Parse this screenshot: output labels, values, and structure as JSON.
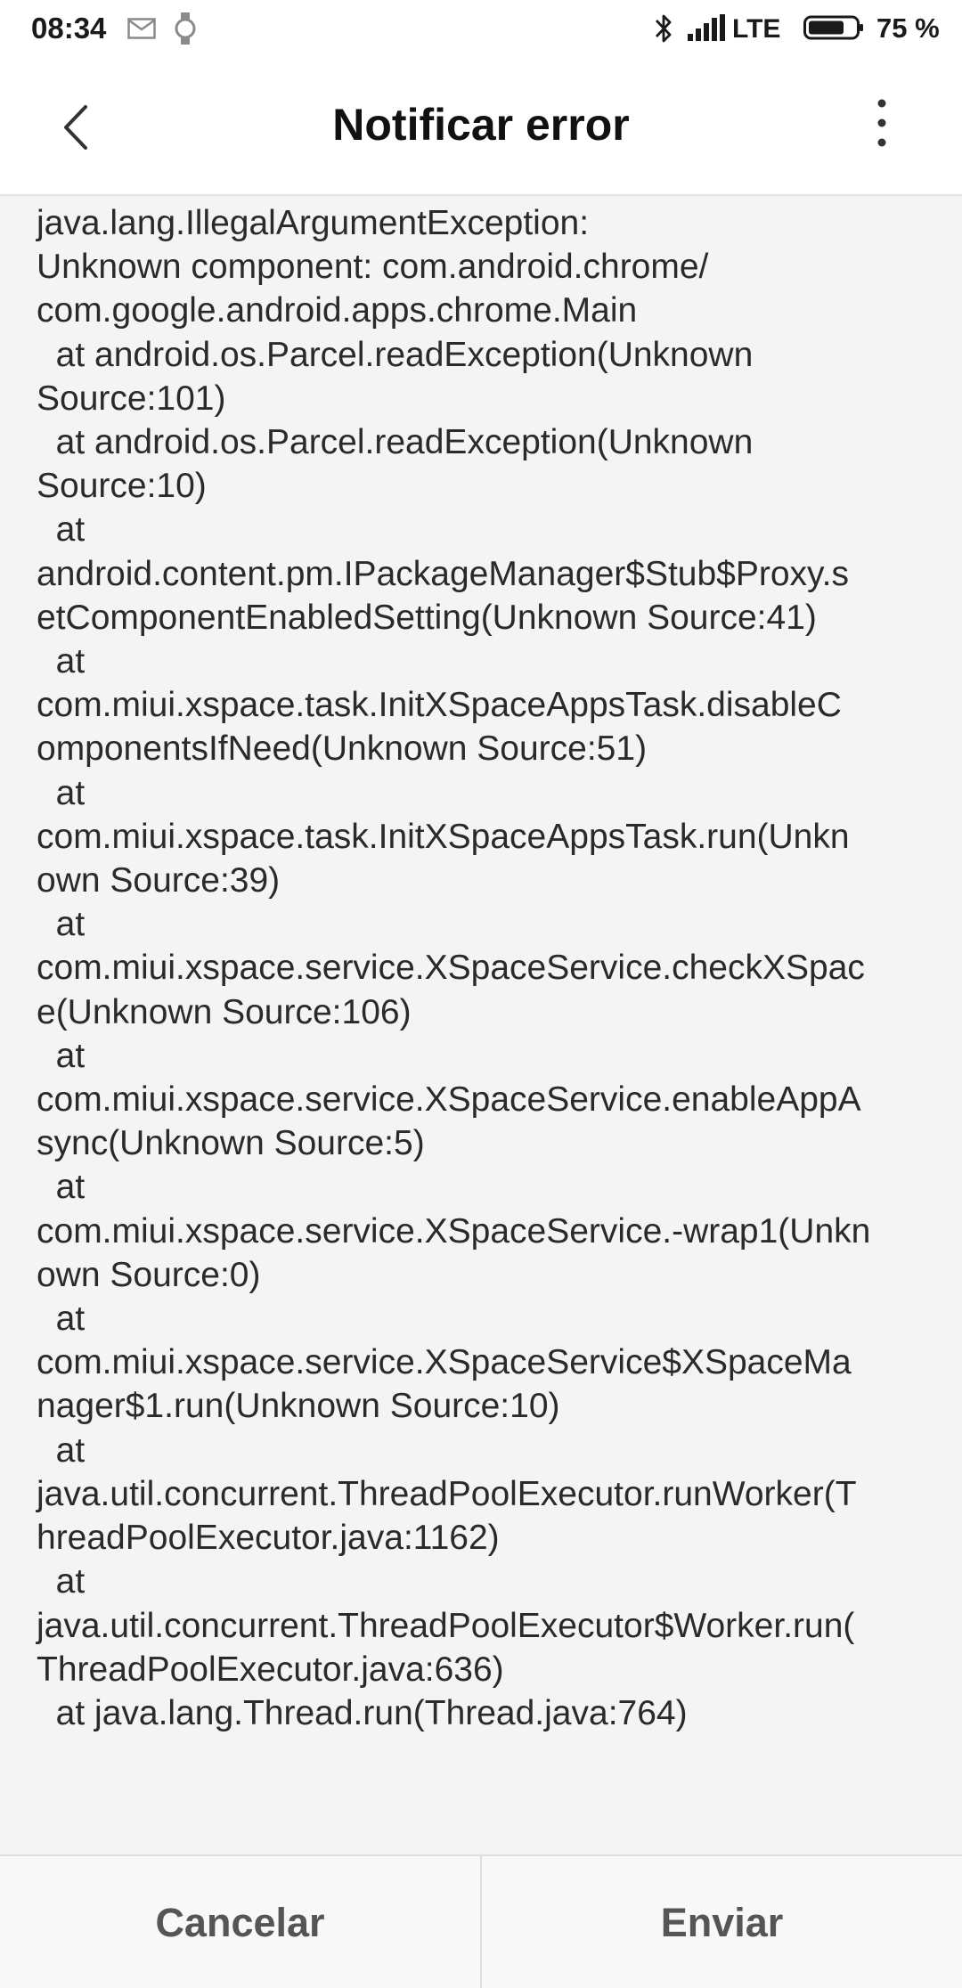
{
  "status_bar": {
    "time": "08:34",
    "network": "LTE",
    "battery": "75 %",
    "icons": [
      "mail-icon",
      "watch-icon",
      "bluetooth-icon",
      "signal-icon",
      "battery-icon"
    ]
  },
  "header": {
    "title": "Notificar error",
    "icons": [
      "back-arrow-icon",
      "more-vert-icon"
    ]
  },
  "error_report": {
    "stack_trace": "java.lang.IllegalArgumentException:\nUnknown component: com.android.chrome/\ncom.google.android.apps.chrome.Main\n  at android.os.Parcel.readException(Unknown\nSource:101)\n  at android.os.Parcel.readException(Unknown\nSource:10)\n  at\nandroid.content.pm.IPackageManager$Stub$Proxy.s\netComponentEnabledSetting(Unknown Source:41)\n  at\ncom.miui.xspace.task.InitXSpaceAppsTask.disableC\nomponentsIfNeed(Unknown Source:51)\n  at\ncom.miui.xspace.task.InitXSpaceAppsTask.run(Unkn\nown Source:39)\n  at\ncom.miui.xspace.service.XSpaceService.checkXSpac\ne(Unknown Source:106)\n  at\ncom.miui.xspace.service.XSpaceService.enableAppA\nsync(Unknown Source:5)\n  at\ncom.miui.xspace.service.XSpaceService.-wrap1(Unkn\nown Source:0)\n  at\ncom.miui.xspace.service.XSpaceService$XSpaceMa\nnager$1.run(Unknown Source:10)\n  at\njava.util.concurrent.ThreadPoolExecutor.runWorker(T\nhreadPoolExecutor.java:1162)\n  at\njava.util.concurrent.ThreadPoolExecutor$Worker.run(\nThreadPoolExecutor.java:636)\n  at java.lang.Thread.run(Thread.java:764)"
  },
  "actions": {
    "cancel_label": "Cancelar",
    "send_label": "Enviar"
  }
}
